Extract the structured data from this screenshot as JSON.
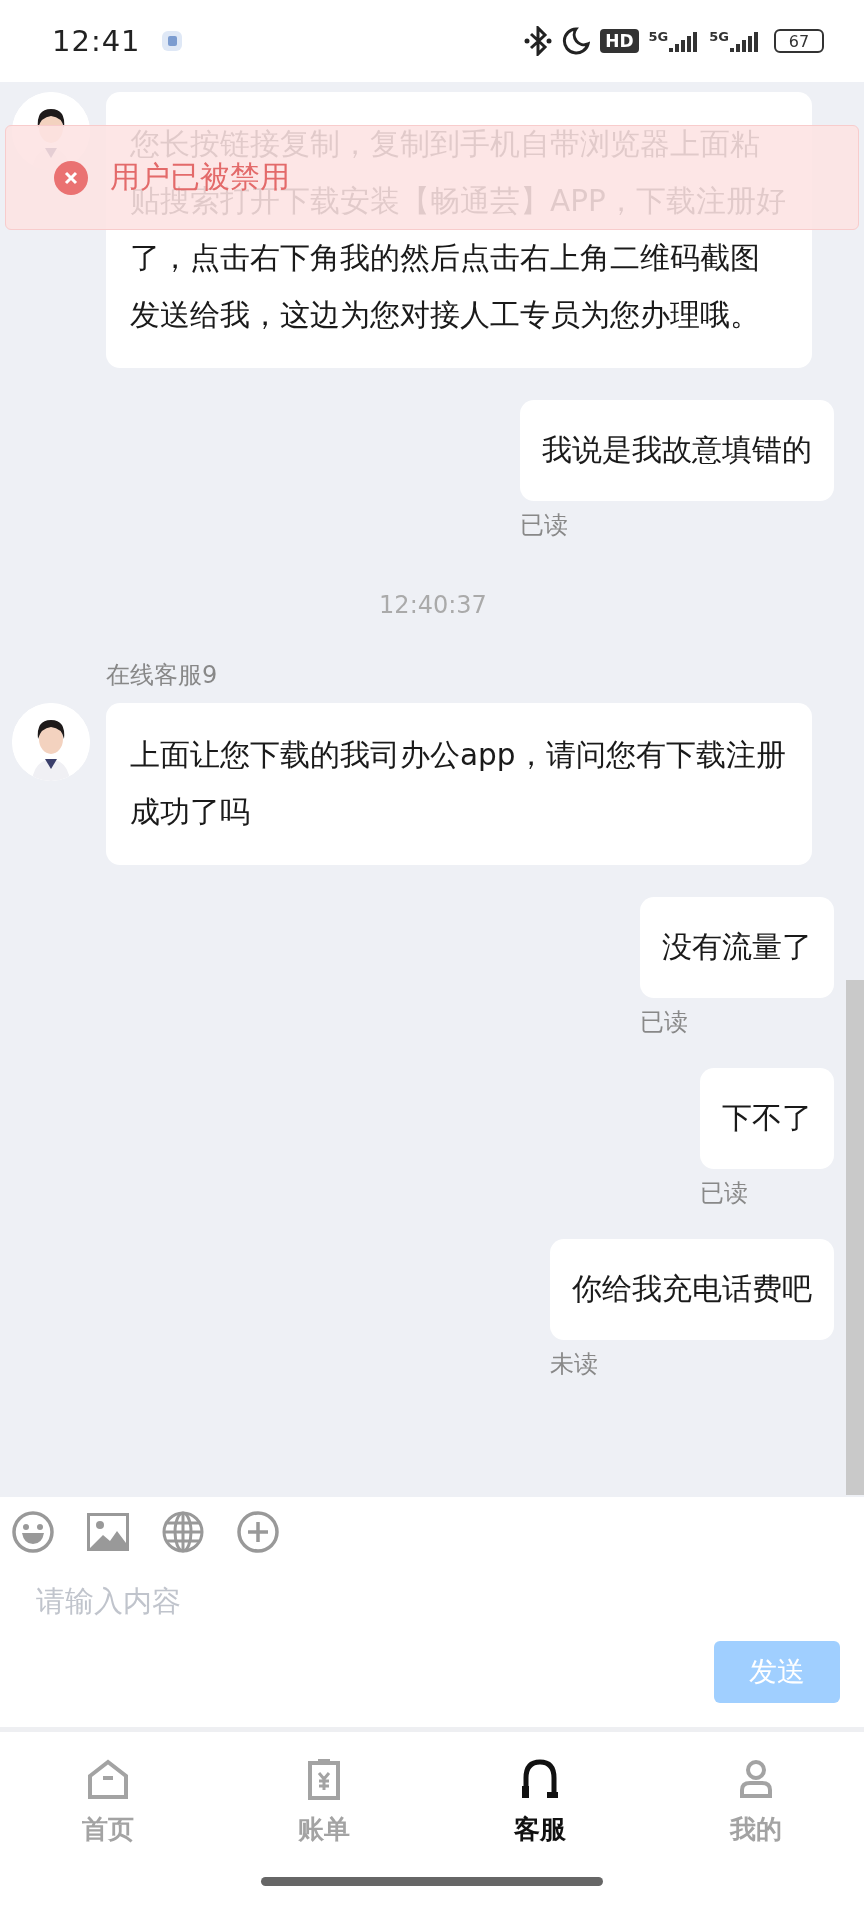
{
  "status_bar": {
    "time": "12:41",
    "hd": "HD",
    "networks": [
      "5G",
      "5G"
    ],
    "battery": "67"
  },
  "toast": {
    "kind": "error",
    "text": "用户已被禁用"
  },
  "messages": [
    {
      "kind": "incoming",
      "text": "您长按链接复制，复制到手机自带浏览器上面粘贴搜索打开下载安装【畅通芸】APP，下载注册好了，点击右下角我的然后点击右上角二维码截图发送给我，这边为您对接人工专员为您办理哦。"
    },
    {
      "kind": "outgoing",
      "text": "我说是我故意填错的",
      "status": "已读"
    },
    {
      "kind": "time",
      "text": "12:40:37"
    },
    {
      "kind": "incoming",
      "sender": "在线客服9",
      "text": "上面让您下载的我司办公app，请问您有下载注册成功了吗"
    },
    {
      "kind": "outgoing",
      "text": "没有流量了",
      "status": "已读"
    },
    {
      "kind": "outgoing",
      "text": "下不了",
      "status": "已读"
    },
    {
      "kind": "outgoing",
      "text": "你给我充电话费吧",
      "status": "未读"
    }
  ],
  "composer": {
    "placeholder": "请输入内容",
    "send": "发送",
    "send_disabled": true
  },
  "tabs": [
    {
      "label": "首页",
      "kind": "home",
      "selected": false
    },
    {
      "label": "账单",
      "kind": "bill",
      "selected": false
    },
    {
      "label": "客服",
      "kind": "service",
      "selected": true
    },
    {
      "label": "我的",
      "kind": "me",
      "selected": false
    }
  ]
}
